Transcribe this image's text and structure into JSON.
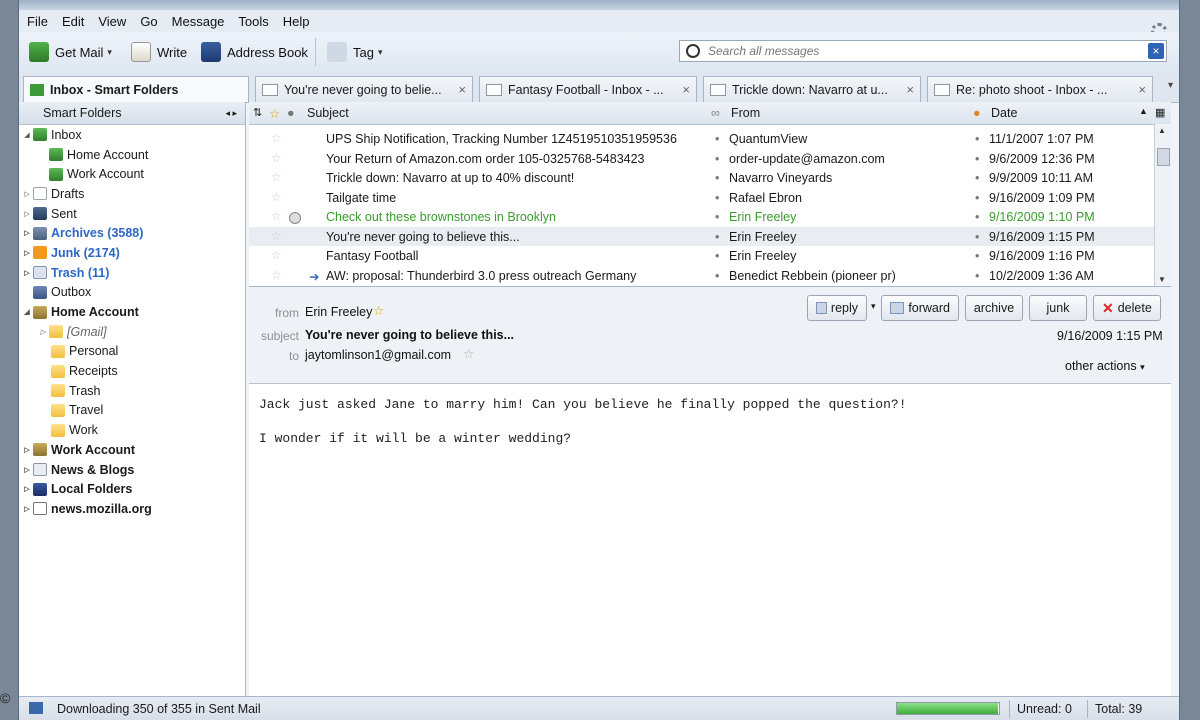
{
  "menu": [
    "File",
    "Edit",
    "View",
    "Go",
    "Message",
    "Tools",
    "Help"
  ],
  "toolbar": {
    "get_mail": "Get Mail",
    "write": "Write",
    "address_book": "Address Book",
    "tag": "Tag",
    "search_placeholder": "Search all messages"
  },
  "tabs": [
    "Inbox - Smart Folders",
    "You're never going to belie...",
    "Fantasy Football - Inbox - ...",
    "Trickle down: Navarro at u...",
    "Re: photo shoot - Inbox - ..."
  ],
  "folders": {
    "header": "Smart Folders",
    "items": [
      "Inbox",
      "Home Account",
      "Work Account",
      "Drafts",
      "Sent",
      "Archives (3588)",
      "Junk (2174)",
      "Trash (11)",
      "Outbox",
      "Home Account",
      "[Gmail]",
      "Personal",
      "Receipts",
      "Trash",
      "Travel",
      "Work",
      "Work Account",
      "News & Blogs",
      "Local Folders",
      "news.mozilla.org"
    ]
  },
  "threads": {
    "columns": {
      "subject": "Subject",
      "from": "From",
      "date": "Date"
    },
    "rows": [
      {
        "subject": "UPS Ship Notification, Tracking Number 1Z4519510351959536",
        "from": "QuantumView",
        "date": "11/1/2007 1:07 PM"
      },
      {
        "subject": "Your Return of Amazon.com order 105-0325768-5483423",
        "from": "order-update@amazon.com",
        "date": "9/6/2009 12:36 PM"
      },
      {
        "subject": "Trickle down: Navarro at up to 40% discount!",
        "from": "Navarro Vineyards",
        "date": "9/9/2009 10:11 AM"
      },
      {
        "subject": "Tailgate time",
        "from": "Rafael Ebron",
        "date": "9/16/2009 1:09 PM"
      },
      {
        "subject": "Check out these brownstones in Brooklyn",
        "from": "Erin Freeley",
        "date": "9/16/2009 1:10 PM"
      },
      {
        "subject": "You're never going to believe this...",
        "from": "Erin Freeley",
        "date": "9/16/2009 1:15 PM"
      },
      {
        "subject": "Fantasy Football",
        "from": "Erin Freeley",
        "date": "9/16/2009 1:16 PM"
      },
      {
        "subject": "AW: proposal: Thunderbird 3.0 press outreach Germany",
        "from": "Benedict Rebbein (pioneer pr)",
        "date": "10/2/2009 1:36 AM"
      }
    ]
  },
  "message": {
    "from_label": "from",
    "from": "Erin Freeley",
    "subject_label": "subject",
    "subject": "You're never going to believe this...",
    "to_label": "to",
    "to": "jaytomlinson1@gmail.com",
    "date": "9/16/2009 1:15 PM",
    "buttons": {
      "reply": "reply",
      "forward": "forward",
      "archive": "archive",
      "junk": "junk",
      "delete": "delete"
    },
    "other_actions": "other actions",
    "body_line1": "Jack just asked Jane to marry him! Can you believe he finally popped the question?!",
    "body_line2": "I wonder if it will be a winter wedding?"
  },
  "status": {
    "text": "Downloading 350 of 355 in Sent Mail",
    "progress_fraction": 0.986,
    "unread": "Unread: 0",
    "total": "Total: 39"
  },
  "copyright": "©"
}
